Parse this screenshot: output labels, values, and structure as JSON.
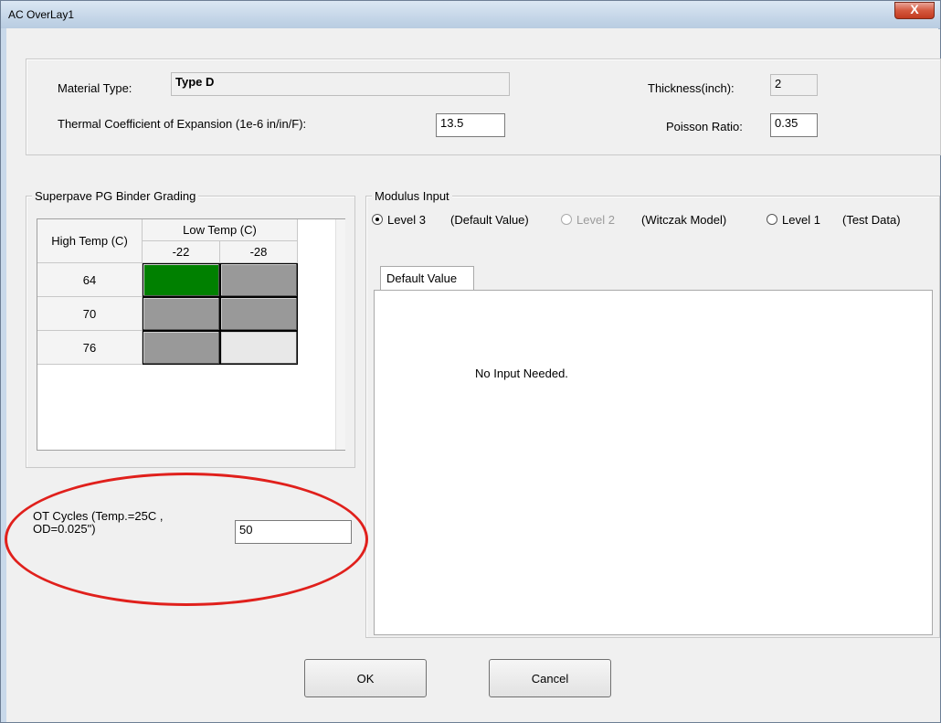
{
  "window": {
    "title": "AC OverLay1",
    "close_glyph": "X"
  },
  "material": {
    "type_label": "Material Type:",
    "type_value": "Type D",
    "thickness_label": "Thickness(inch):",
    "thickness_value": "2",
    "thermal_label": "Thermal Coefficient of Expansion (1e-6 in/in/F):",
    "thermal_value": "13.5",
    "poisson_label": "Poisson Ratio:",
    "poisson_value": "0.35"
  },
  "binder": {
    "group_label": "Superpave PG Binder Grading",
    "high_temp_label": "High Temp (C)",
    "low_temp_label": "Low Temp (C)",
    "low_temps": [
      "-22",
      "-28"
    ],
    "high_temps": [
      "64",
      "70",
      "76"
    ],
    "cells": [
      [
        "selected",
        "available"
      ],
      [
        "available",
        "available"
      ],
      [
        "available",
        "unavailable"
      ]
    ],
    "colors": {
      "selected": "#008000",
      "available": "#999999",
      "unavailable": "#e8e8e8"
    }
  },
  "ot": {
    "label_line1": "OT Cycles (Temp.=25C ,",
    "label_line2": "OD=0.025\")",
    "value": "50"
  },
  "modulus": {
    "group_label": "Modulus Input",
    "options": [
      {
        "level": "Level 3",
        "desc": "(Default Value)",
        "selected": true,
        "enabled": true
      },
      {
        "level": "Level 2",
        "desc": "(Witczak Model)",
        "selected": false,
        "enabled": false
      },
      {
        "level": "Level 1",
        "desc": "(Test Data)",
        "selected": false,
        "enabled": true
      }
    ],
    "tab_label": "Default Value",
    "panel_message": "No Input Needed."
  },
  "buttons": {
    "ok": "OK",
    "cancel": "Cancel"
  },
  "annotation": {
    "color": "#e0201c",
    "shape": "ellipse"
  }
}
